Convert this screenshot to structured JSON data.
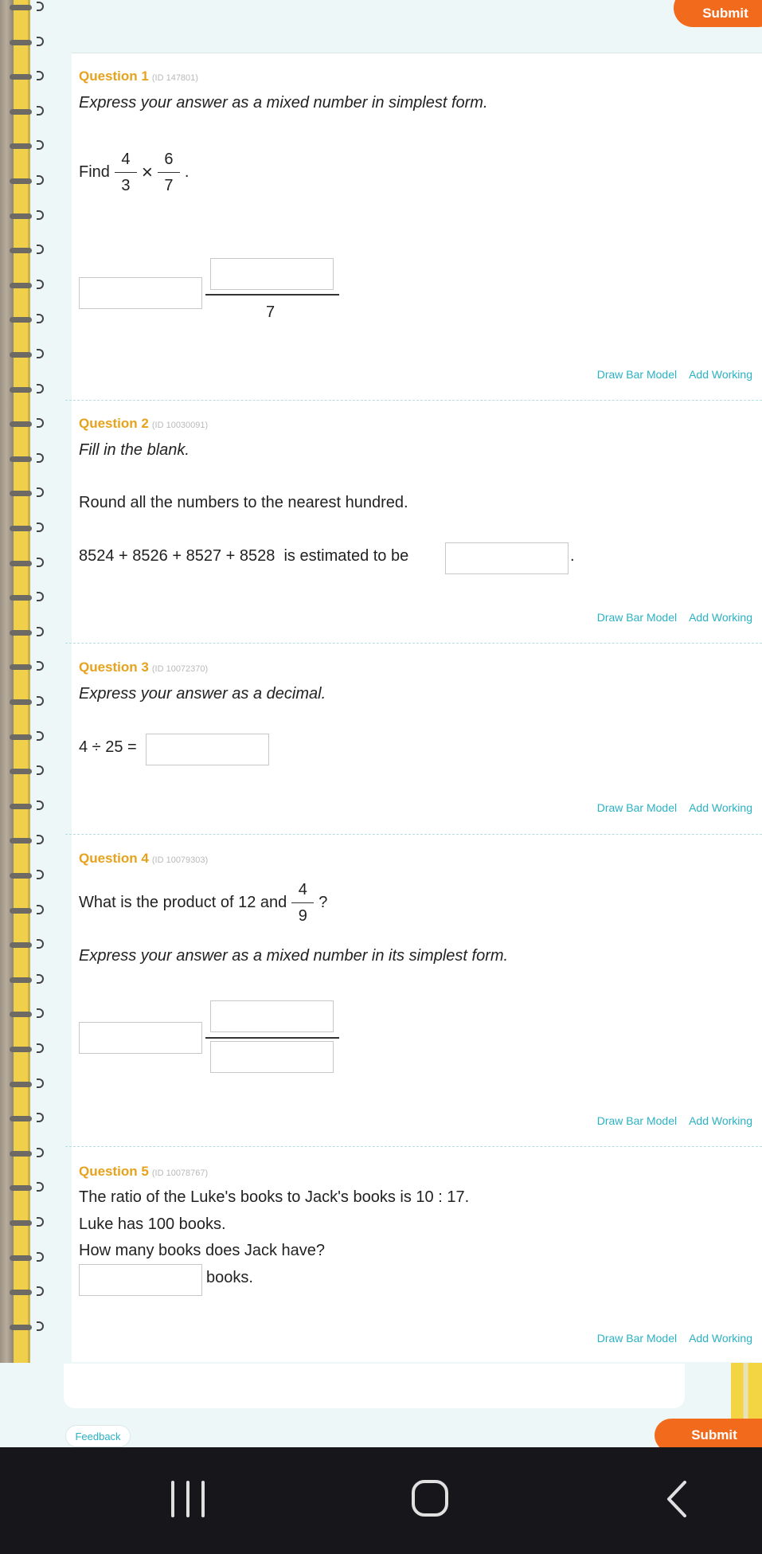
{
  "header": {
    "submit_label": "Submit"
  },
  "questions": [
    {
      "title": "Question 1",
      "id": "(ID 147801)",
      "instruction": "Express your answer as a mixed number in simplest form.",
      "prompt_prefix": "Find",
      "frac_a": {
        "num": "4",
        "den": "3"
      },
      "operator": "×",
      "frac_b": {
        "num": "6",
        "den": "7"
      },
      "prompt_suffix": ".",
      "answer_denominator": "7"
    },
    {
      "title": "Question 2",
      "id": "(ID 10030091)",
      "instruction": "Fill in the blank.",
      "line1": "Round all the numbers to the nearest hundred.",
      "expression": "8524 + 8526 + 8527 + 8528",
      "after": "is estimated to be",
      "suffix": "."
    },
    {
      "title": "Question 3",
      "id": "(ID 10072370)",
      "instruction": "Express your answer as a decimal.",
      "expression": "4 ÷ 25 ="
    },
    {
      "title": "Question 4",
      "id": "(ID 10079303)",
      "prompt_prefix": "What is the product of 12 and",
      "frac": {
        "num": "4",
        "den": "9"
      },
      "prompt_suffix": "?",
      "instruction": "Express your answer as a mixed number in its simplest form."
    },
    {
      "title": "Question 5",
      "id": "(ID 10078767)",
      "line1": "The ratio of the Luke's books to Jack's books is 10 : 17.",
      "line2": "Luke has 100 books.",
      "line3": "How many books does Jack have?",
      "unit": "books."
    }
  ],
  "actions": {
    "draw_bar_model": "Draw Bar Model",
    "add_working": "Add Working"
  },
  "footer": {
    "feedback_label": "Feedback",
    "submit_label": "Submit"
  },
  "colors": {
    "accent_orange": "#f26b1d",
    "question_title": "#e6a21c",
    "link_teal": "#2ab1c4"
  }
}
